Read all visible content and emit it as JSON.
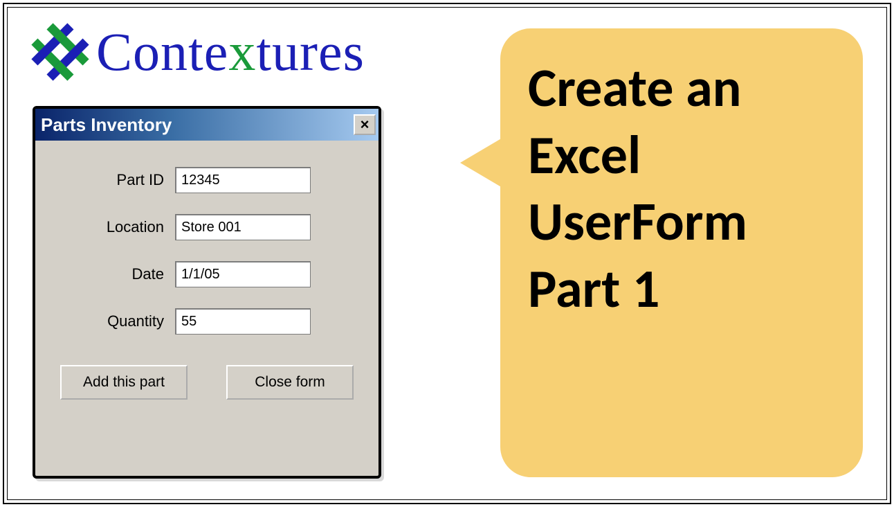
{
  "brand": {
    "name_before_x": "Conte",
    "name_x": "x",
    "name_after_x": "tures"
  },
  "userform": {
    "title": "Parts Inventory",
    "close_glyph": "×",
    "fields": {
      "part_id": {
        "label": "Part ID",
        "value": "12345"
      },
      "location": {
        "label": "Location",
        "value": "Store 001"
      },
      "date": {
        "label": "Date",
        "value": "1/1/05"
      },
      "quantity": {
        "label": "Quantity",
        "value": "55"
      }
    },
    "buttons": {
      "add": "Add this part",
      "close": "Close form"
    }
  },
  "callout": {
    "text": "Create an\nExcel\nUserForm\nPart 1"
  }
}
